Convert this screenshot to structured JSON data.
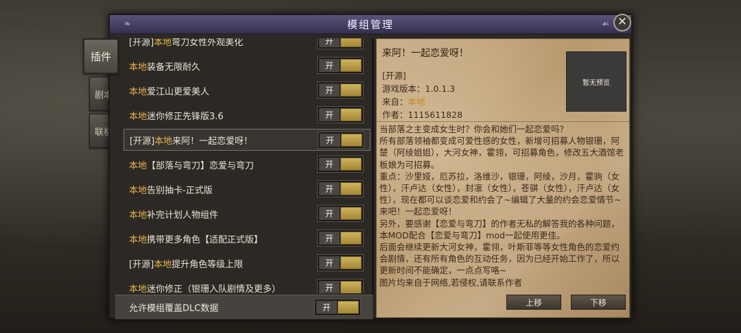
{
  "window": {
    "title": "模组管理"
  },
  "tabs": [
    {
      "label": "插件",
      "active": true
    },
    {
      "label": "剧本",
      "active": false
    },
    {
      "label": "联机",
      "active": false
    }
  ],
  "mods": [
    {
      "prefix": "[开源]",
      "source": "本地",
      "name": "弯刀女性外观美化",
      "toggle": "开"
    },
    {
      "prefix": "",
      "source": "本地",
      "name": "装备无限耐久",
      "toggle": "开"
    },
    {
      "prefix": "",
      "source": "本地",
      "name": "爱江山更爱美人",
      "toggle": "开"
    },
    {
      "prefix": "",
      "source": "本地",
      "name": "迷你修正先锋版3.6",
      "toggle": "开"
    },
    {
      "prefix": "[开源]",
      "source": "本地",
      "name": "来阿！一起恋爱呀！",
      "toggle": "开",
      "selected": true
    },
    {
      "prefix": "",
      "source": "本地",
      "name": "【部落与弯刀】恋爱与弯刀",
      "toggle": "开"
    },
    {
      "prefix": "",
      "source": "本地",
      "name": "告别抽卡-正式版",
      "toggle": "开"
    },
    {
      "prefix": "",
      "source": "本地",
      "name": "补完计划人物组件",
      "toggle": "开"
    },
    {
      "prefix": "",
      "source": "本地",
      "name": "携带更多角色【适配正式版】",
      "toggle": "开"
    },
    {
      "prefix": "[开源]",
      "source": "本地",
      "name": "提升角色等级上限",
      "toggle": "开"
    },
    {
      "prefix": "",
      "source": "本地",
      "name": "迷你修正（银珊入队剧情及更多）",
      "toggle": "开"
    }
  ],
  "bottom": {
    "label": "允许模组覆盖DLC数据",
    "toggle": "开"
  },
  "detail": {
    "title": "来阿！一起恋爱呀！",
    "tag": "[开源]",
    "version_label": "游戏版本：",
    "version": "1.0.1.3",
    "from_label": "来自：",
    "from": "本地",
    "author_label": "作者：",
    "author": "1115611828",
    "preview_text": "暂无预览",
    "description": [
      "当部落之主变成女生时？你会和她们一起恋爱吗？",
      "所有部落领袖都变成可爱性感的女性，新增可招募人物银珊，阿楚（阿绫姐姐），大河女神，霍翎，可招募角色，修改五大酒馆老板娘为可招募。",
      "重点：沙里娅，厄苏拉，洛维沙，银珊，阿绫，沙月，霍驹（女性），汗卢达（女性），封凛（女性），苍骐（女性），汗卢达（女性），现在都可以谈恋爱和约会了~编辑了大量的约会恋爱情节~来吧！一起恋爱呀！",
      "另外，要感谢【恋爱与弯刀】的作者无私的解答我的各种问题，本MOD配合【恋爱与弯刀】mod一起使用更佳。",
      "后面会继续更新大河女神，霍翎，叶斯菲等等女性角色的恋爱约会剧情，还有所有角色的互动任务，因为已经开始工作了，所以更新时间不能确定，一点点写咯~",
      "图片均来自于网络,若侵权,请联系作者"
    ],
    "move_up": "上移",
    "move_down": "下移"
  }
}
